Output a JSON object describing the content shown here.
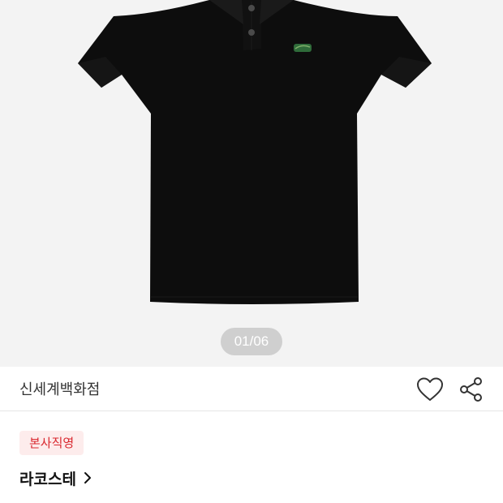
{
  "gallery": {
    "page_indicator": "01/06",
    "image_alt": "black polo shirt"
  },
  "product": {
    "store_name": "신세계백화점",
    "badge": "본사직영",
    "brand": "라코스테"
  },
  "icons": {
    "wishlist": "heart-icon",
    "share": "share-icon",
    "brand_arrow": "chevron-right-icon"
  },
  "colors": {
    "badge_text": "#d9272e",
    "badge_bg": "#fdecec",
    "gallery_bg": "#f3f3f3"
  }
}
